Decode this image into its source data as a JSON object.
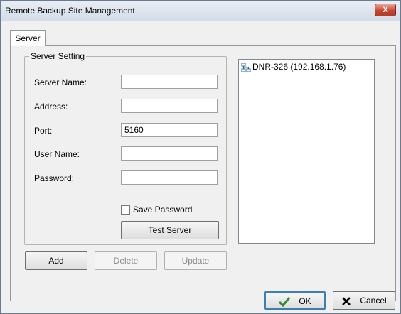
{
  "window": {
    "title": "Remote Backup Site Management",
    "close_glyph": "X"
  },
  "tabs": [
    {
      "label": "Server",
      "selected": true
    }
  ],
  "server_setting": {
    "group_label": "Server Setting",
    "fields": {
      "server_name": {
        "label": "Server Name:",
        "value": ""
      },
      "address": {
        "label": "Address:",
        "value": ""
      },
      "port": {
        "label": "Port:",
        "value": "5160"
      },
      "user_name": {
        "label": "User Name:",
        "value": ""
      },
      "password": {
        "label": "Password:",
        "value": ""
      }
    },
    "save_password": {
      "label": "Save Password",
      "checked": false
    },
    "test_server_label": "Test Server"
  },
  "server_list": {
    "items": [
      {
        "label": "DNR-326 (192.168.1.76)",
        "icon": "network-icon"
      }
    ]
  },
  "actions": {
    "add_label": "Add",
    "delete_label": "Delete",
    "update_label": "Update"
  },
  "dialog_buttons": {
    "ok_label": "OK",
    "cancel_label": "Cancel"
  },
  "colors": {
    "ok_check": "#2e8b2e",
    "close_button": "#c84731",
    "network_icon": "#2a5fa8"
  }
}
